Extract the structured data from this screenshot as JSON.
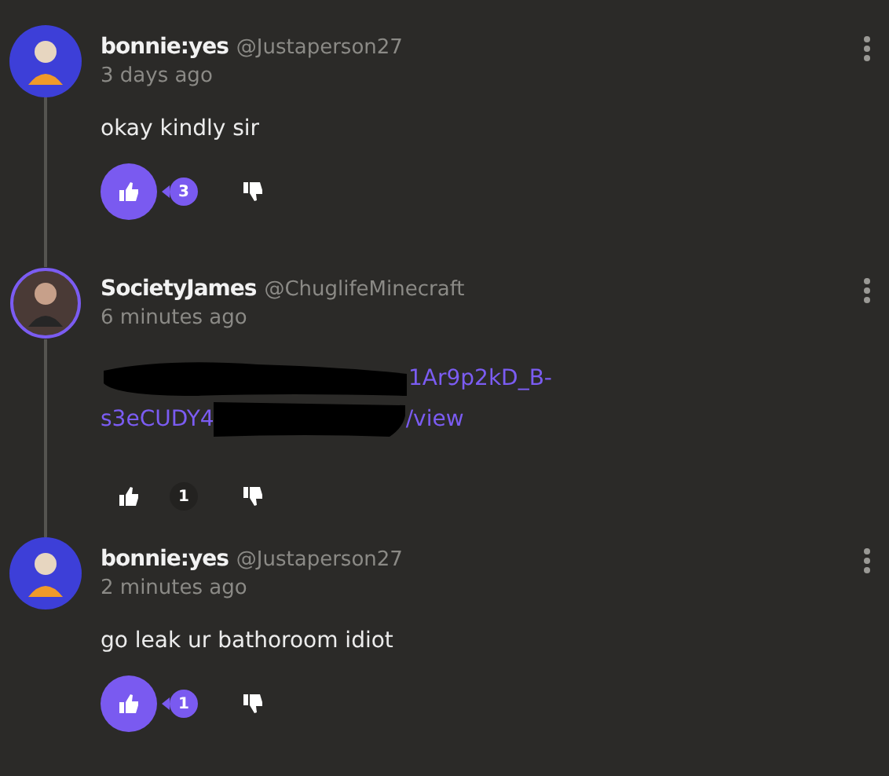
{
  "comments": [
    {
      "author": "bonnie:yes",
      "handle": "@Justaperson27",
      "time": "3 days ago",
      "kind": "text",
      "body": "okay kindly sir",
      "avatar_ring": false,
      "liked": true,
      "likes": "3"
    },
    {
      "author": "SocietyJames",
      "handle": "@ChuglifeMinecraft",
      "time": "6 minutes ago",
      "kind": "link",
      "link_lines": [
        "1Ar9p2kD_B-",
        "s3eCUDY4",
        "/view"
      ],
      "avatar_ring": true,
      "liked": false,
      "likes": "1"
    },
    {
      "author": "bonnie:yes",
      "handle": "@Justaperson27",
      "time": "2 minutes ago",
      "kind": "text",
      "body": "go leak ur bathoroom idiot",
      "avatar_ring": false,
      "liked": true,
      "likes": "1"
    }
  ]
}
